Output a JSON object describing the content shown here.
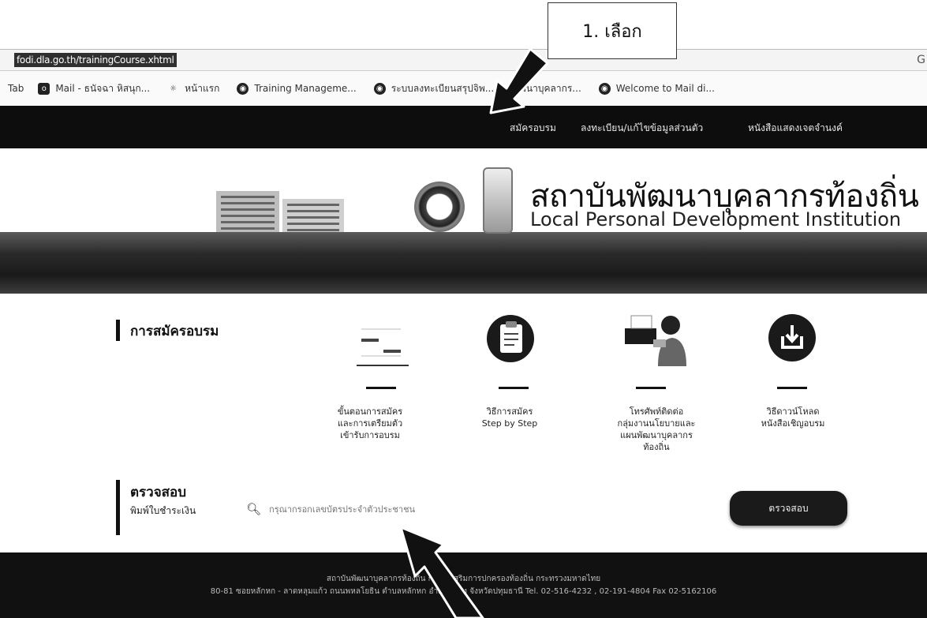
{
  "callout": {
    "text": "1. เลือก"
  },
  "browser": {
    "url": "fodi.dla.go.th/trainingCourse.xhtml",
    "bookmarks": [
      {
        "icon": "mail-icon",
        "label": "Mail - ธนัจฉา หิสนุก..."
      },
      {
        "icon": "bookmark-icon",
        "label": "หน้าแรก"
      },
      {
        "icon": "globe-icon",
        "label": "Training Manageme..."
      },
      {
        "icon": "globe-icon",
        "label": "ระบบลงทะเบียนสรุปจิพ..."
      },
      {
        "icon": "globe-icon",
        "label": "พัฒนาบุคลากร..."
      },
      {
        "icon": "globe-icon",
        "label": "Welcome to Mail di..."
      }
    ],
    "tab_label": "Tab"
  },
  "nav": {
    "items": [
      "สมัครอบรม",
      "ลงทะเบียน/แก้ไขข้อมูลส่วนตัว",
      "หนังสือแสดงเจตจำนงค์"
    ]
  },
  "banner": {
    "title_th": "สถาบันพัฒนาบุคลากรท้องถิ่น",
    "title_en": "Local Personal Development Institution"
  },
  "register": {
    "heading": "การสมัครอบรม",
    "cards": [
      {
        "icon": "document-steps-icon",
        "lines": [
          "ขั้นตอนการสมัคร",
          "และการเตรียมตัว",
          "เข้ารับการอบรม"
        ]
      },
      {
        "icon": "clipboard-icon",
        "lines": [
          "วิธีการสมัคร",
          "Step by Step"
        ]
      },
      {
        "icon": "contact-person-icon",
        "lines": [
          "โทรศัพท์ติดต่อ",
          "กลุ่มงานนโยบายและ",
          "แผนพัฒนาบุคลากร",
          "ท้องถิ่น"
        ]
      },
      {
        "icon": "download-icon",
        "lines": [
          "วิธีดาวน์โหลด",
          "หนังสือเชิญอบรม"
        ]
      }
    ]
  },
  "check": {
    "heading": "ตรวจสอบ",
    "label": "พิมพ์ใบชำระเงิน",
    "placeholder": "กรุณากรอกเลขบัตรประจำตัวประชาชน",
    "button": "ตรวจสอบ"
  },
  "footer": {
    "line1": "สถาบันพัฒนาบุคลากรท้องถิ่น กรมส่งเสริมการปกครองท้องถิ่น กระทรวงมหาดไทย",
    "line2": "80-81 ซอยหลักหก - ลาดหลุมแก้ว ถนนพหลโยธิน ตำบลหลักหก อำเภอเมือง จังหวัดปทุมธานี Tel. 02-516-4232 , 02-191-4804 Fax 02-5162106"
  }
}
